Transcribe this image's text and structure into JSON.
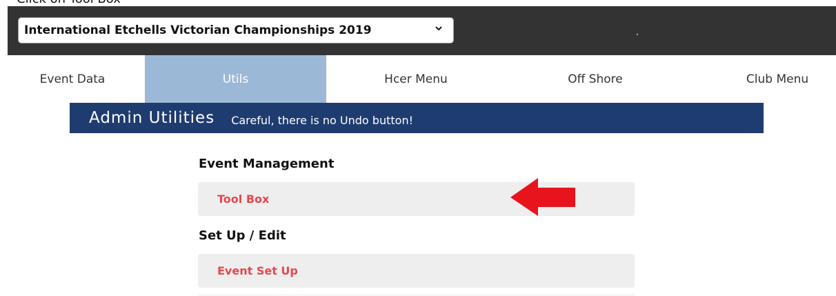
{
  "instruction": "Click on Tool Box",
  "header": {
    "event_select_value": "International Etchells Victorian Championships 2019",
    "dot": "."
  },
  "nav": {
    "tabs": [
      {
        "label": "Event Data",
        "active": false
      },
      {
        "label": "Utils",
        "active": true
      },
      {
        "label": "Hcer Menu",
        "active": false
      },
      {
        "label": "Off Shore",
        "active": false
      },
      {
        "label": "Club Menu",
        "active": false
      }
    ]
  },
  "admin": {
    "title": "Admin Utilities",
    "warning": "Careful, there is no Undo button!"
  },
  "sections": [
    {
      "heading": "Event Management",
      "items": [
        {
          "label": "Tool Box"
        }
      ]
    },
    {
      "heading": "Set Up / Edit",
      "items": [
        {
          "label": "Event Set Up"
        }
      ]
    }
  ],
  "colors": {
    "topbar": "#333333",
    "active_tab": "#9bb8d7",
    "banner": "#1f3c70",
    "menu_text": "#e8464a",
    "menu_bg": "#eeeeef",
    "arrow": "#e8141c"
  },
  "icons": {
    "select": "chevron-down-icon",
    "pointer": "arrow-left-icon"
  }
}
